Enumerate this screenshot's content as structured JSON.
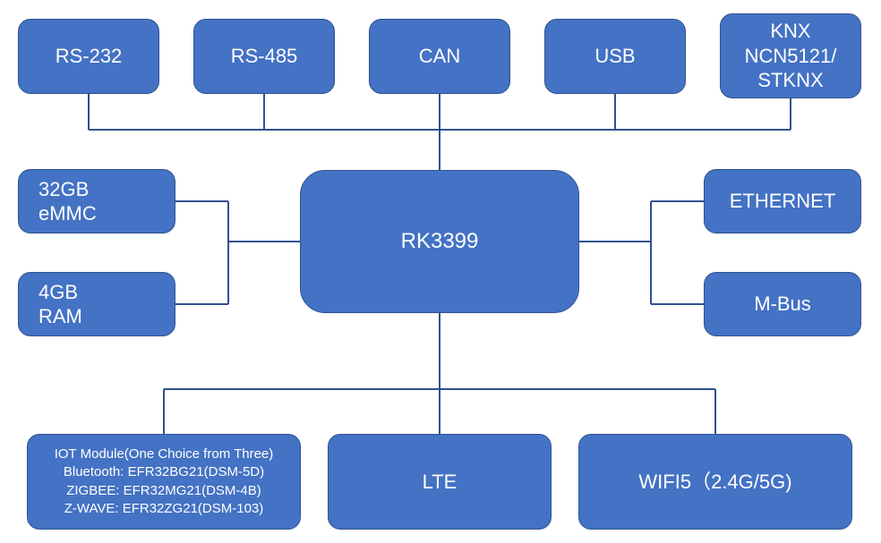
{
  "colors": {
    "box_fill": "#4472c4",
    "box_border": "#2f528f",
    "connector": "#2f528f",
    "text": "#ffffff"
  },
  "central": {
    "label": "RK3399"
  },
  "top_row": [
    {
      "id": "rs232",
      "label": "RS-232"
    },
    {
      "id": "rs485",
      "label": "RS-485"
    },
    {
      "id": "can",
      "label": "CAN"
    },
    {
      "id": "usb",
      "label": "USB"
    },
    {
      "id": "knx",
      "label": "KNX\nNCN5121/\nSTKNX"
    }
  ],
  "left_col": [
    {
      "id": "emmc",
      "label": "32GB\neMMC"
    },
    {
      "id": "ram",
      "label": "4GB\nRAM"
    }
  ],
  "right_col": [
    {
      "id": "eth",
      "label": "ETHERNET"
    },
    {
      "id": "mbus",
      "label": "M-Bus"
    }
  ],
  "bottom_row": [
    {
      "id": "iot",
      "label": "IOT Module(One Choice from Three)\nBluetooth: EFR32BG21(DSM-5D)\nZIGBEE: EFR32MG21(DSM-4B)\nZ-WAVE: EFR32ZG21(DSM-103)"
    },
    {
      "id": "lte",
      "label": "LTE"
    },
    {
      "id": "wifi",
      "label": "WIFI5（2.4G/5G)"
    }
  ]
}
